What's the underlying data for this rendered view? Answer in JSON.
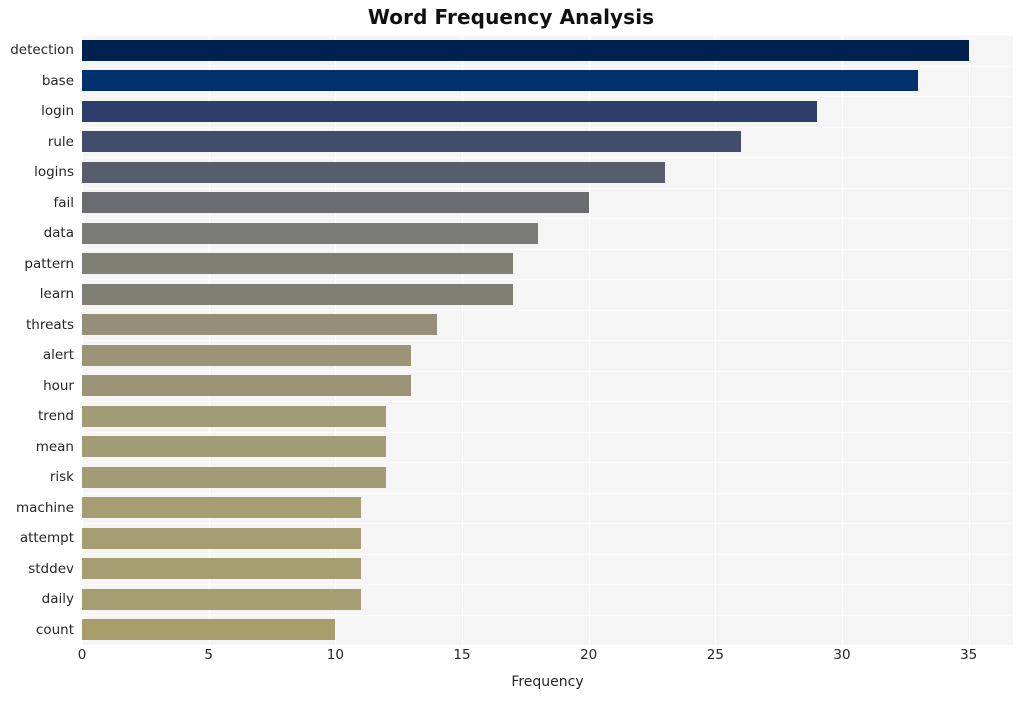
{
  "chart_data": {
    "type": "bar",
    "orientation": "horizontal",
    "title": "Word Frequency Analysis",
    "xlabel": "Frequency",
    "ylabel": "",
    "categories": [
      "detection",
      "base",
      "login",
      "rule",
      "logins",
      "fail",
      "data",
      "pattern",
      "learn",
      "threats",
      "alert",
      "hour",
      "trend",
      "mean",
      "risk",
      "machine",
      "attempt",
      "stddev",
      "daily",
      "count"
    ],
    "values": [
      35,
      33,
      29,
      26,
      23,
      20,
      18,
      17,
      17,
      14,
      13,
      13,
      12,
      12,
      12,
      11,
      11,
      11,
      11,
      10
    ],
    "xlim": [
      0,
      36.75
    ],
    "xticks": [
      0,
      5,
      10,
      15,
      20,
      25,
      30,
      35
    ],
    "xticklabels": [
      "0",
      "5",
      "10",
      "15",
      "20",
      "25",
      "30",
      "35"
    ],
    "grid": true,
    "legend": null,
    "colormap": "cividis",
    "bar_colors": [
      "#00224e",
      "#01306f",
      "#2c3e6b",
      "#414d6b",
      "#575d6d",
      "#6b6c71",
      "#7a7b78",
      "#7f7f76",
      "#7f7f76",
      "#958f78",
      "#9c9476",
      "#9c9476",
      "#a39a76",
      "#a39a76",
      "#a39a76",
      "#a79d73",
      "#a79d73",
      "#a79d73",
      "#a79d73",
      "#a99d6b"
    ]
  },
  "style": {
    "figure_background": "#ffffff",
    "axes_background": "#f5f5f5",
    "grid_color": "#ffffff",
    "text_color": "#262626",
    "title_color": "#111111"
  }
}
